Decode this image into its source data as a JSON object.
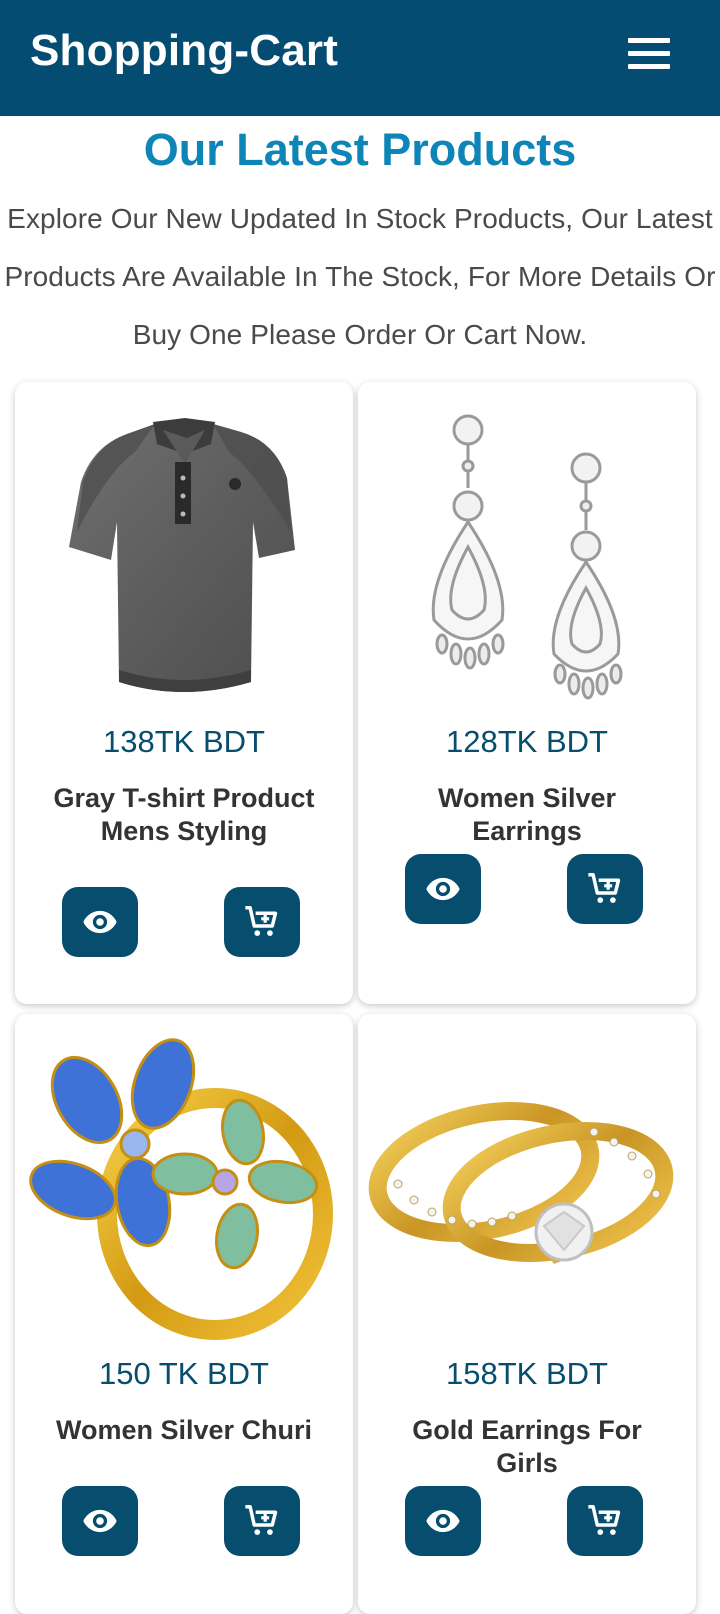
{
  "header": {
    "brand": "Shopping-Cart",
    "menu_icon": "hamburger-menu-icon",
    "background": "#044c72"
  },
  "section": {
    "title": "Our Latest Products",
    "description": "Explore Our New Updated In Stock Products, Our Latest Products Are Available In The Stock, For More Details Or Buy One Please Order Or Cart Now.",
    "title_color": "#0e85b7"
  },
  "products": [
    {
      "price": "138TK BDT",
      "name": "Gray T-shirt Product Mens Styling",
      "image": "gray-polo-tshirt-image",
      "view_icon": "eye-icon",
      "cart_icon": "cart-plus-icon"
    },
    {
      "price": "128TK BDT",
      "name": "Women Silver Earrings",
      "image": "silver-drop-earrings-image",
      "view_icon": "eye-icon",
      "cart_icon": "cart-plus-icon"
    },
    {
      "price": "150 TK BDT",
      "name": "Women Silver Churi",
      "image": "gold-flower-ring-image",
      "view_icon": "eye-icon",
      "cart_icon": "cart-plus-icon"
    },
    {
      "price": "158TK BDT",
      "name": "Gold Earrings For Girls",
      "image": "gold-wedding-rings-image",
      "view_icon": "eye-icon",
      "cart_icon": "cart-plus-icon"
    }
  ],
  "colors": {
    "accent": "#074d6e",
    "price_text": "#074d6e",
    "name_text": "#333333"
  }
}
